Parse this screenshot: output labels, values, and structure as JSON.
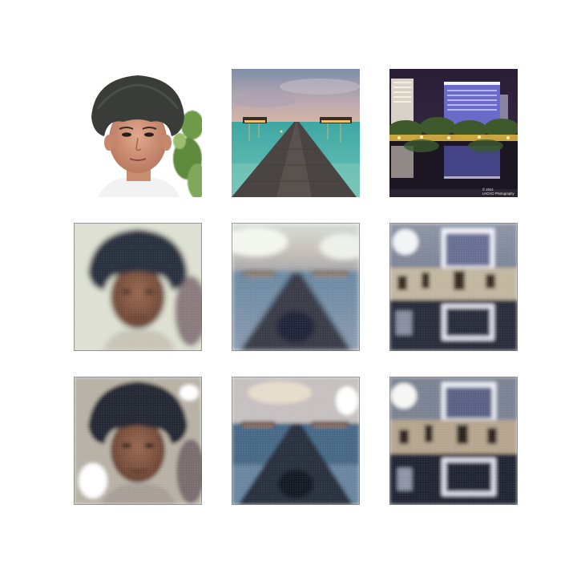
{
  "grid": {
    "rows": [
      {
        "role": "original",
        "items": [
          "portrait-boy",
          "overwater-jetty",
          "city-night-reflection"
        ]
      },
      {
        "role": "reconstruction-a",
        "items": [
          "portrait-boy",
          "overwater-jetty",
          "city-night-reflection"
        ]
      },
      {
        "role": "reconstruction-b",
        "items": [
          "portrait-boy",
          "overwater-jetty",
          "city-night-reflection"
        ]
      }
    ]
  },
  "watermark": {
    "line1": "© 2014",
    "line2": "LHCHO Photography"
  },
  "colors": {
    "background": "#ffffff",
    "sky_blue": "#8a9ab0",
    "water_teal": "#4fb0a6",
    "night_sky": "#241a2e"
  }
}
